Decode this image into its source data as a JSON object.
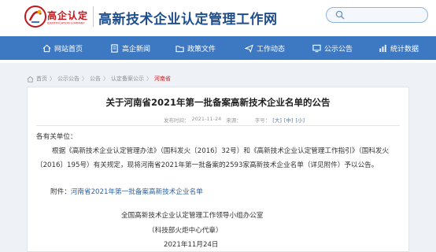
{
  "header": {
    "logo_cn": "高企认定",
    "logo_en": "IDENTIFICATION COMPANY",
    "site_title": "高新技术企业认定管理工作网",
    "search_placeholder": ""
  },
  "nav": {
    "items": [
      {
        "label": "网站首页",
        "icon": "home-icon"
      },
      {
        "label": "高企新闻",
        "icon": "document-icon"
      },
      {
        "label": "政策文件",
        "icon": "folder-icon"
      },
      {
        "label": "工作动态",
        "icon": "send-icon"
      },
      {
        "label": "公示公告",
        "icon": "monitor-icon"
      },
      {
        "label": "统计数据",
        "icon": "chart-icon"
      }
    ]
  },
  "breadcrumb": {
    "items": [
      "首页",
      "公示公告",
      "公告",
      "认定备案公示",
      "河南省"
    ],
    "separator": "〉"
  },
  "article": {
    "title": "关于河南省2021年第一批备案高新技术企业名单的公告",
    "meta": {
      "date_label": "发布时间：",
      "date": "2021-11-24",
      "source_label": "来源：",
      "size_label": "字号：",
      "size_options": [
        "[大]",
        "[中]",
        "[小]"
      ]
    },
    "salutation": "各有关单位：",
    "paragraph_lines": [
      "根据《高新技术企业认定管理办法》（国科发火〔2016〕32号）和《高新技术企业认定管理工作指引》（国科发火",
      "〔2016〕195号）有关规定，现将河南省2021年第一批备案的2593家高新技术企业名单（详见附件）予以公告。"
    ],
    "attachment_label": "附件：",
    "attachment_link": "河南省2021年第一批备案高新技术企业名单",
    "signature": "全国高新技术企业认定管理工作领导小组办公室",
    "signature_sub": "（科技部火炬中心代章）",
    "signature_date": "2021年11月24日"
  },
  "colors": {
    "brand_blue": "#1f4e8c",
    "nav_blue": "#3d79c2",
    "logo_red": "#c4161c"
  }
}
